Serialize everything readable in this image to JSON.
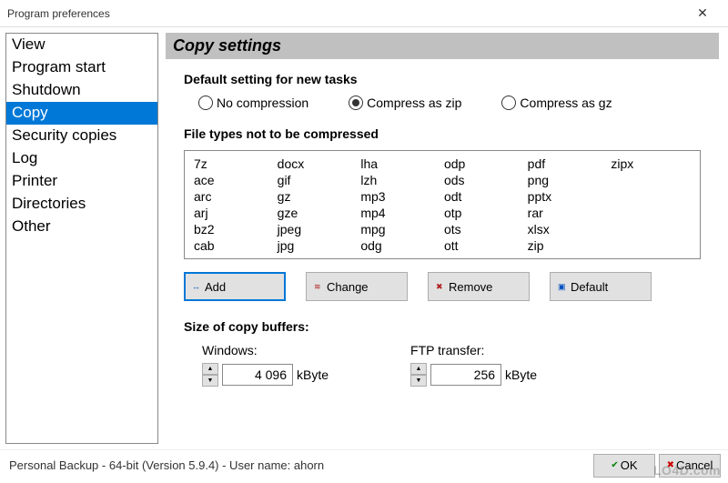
{
  "window": {
    "title": "Program preferences"
  },
  "sidebar": {
    "items": [
      {
        "label": "View"
      },
      {
        "label": "Program start"
      },
      {
        "label": "Shutdown"
      },
      {
        "label": "Copy"
      },
      {
        "label": "Security copies"
      },
      {
        "label": "Log"
      },
      {
        "label": "Printer"
      },
      {
        "label": "Directories"
      },
      {
        "label": "Other"
      }
    ],
    "selected_index": 3
  },
  "section": {
    "header": "Copy settings",
    "default_heading": "Default setting for new tasks",
    "radios": {
      "none": "No compression",
      "zip": "Compress as zip",
      "gz": "Compress as gz",
      "selected": "zip"
    },
    "filetypes_heading": "File types not to be compressed",
    "filetypes_columns": [
      [
        "7z",
        "ace",
        "arc",
        "arj",
        "bz2",
        "cab"
      ],
      [
        "docx",
        "gif",
        "gz",
        "gze",
        "jpeg",
        "jpg"
      ],
      [
        "lha",
        "lzh",
        "mp3",
        "mp4",
        "mpg",
        "odg"
      ],
      [
        "odp",
        "ods",
        "odt",
        "otp",
        "ots",
        "ott"
      ],
      [
        "pdf",
        "png",
        "pptx",
        "rar",
        "xlsx",
        "zip"
      ],
      [
        "zipx",
        "",
        "",
        "",
        "",
        ""
      ]
    ],
    "buttons": {
      "add": "Add",
      "change": "Change",
      "remove": "Remove",
      "default": "Default"
    },
    "buffers": {
      "heading": "Size of copy buffers:",
      "windows_label": "Windows:",
      "windows_value": "4 096",
      "ftp_label": "FTP transfer:",
      "ftp_value": "256",
      "unit": "kByte"
    }
  },
  "footer": {
    "status": "Personal Backup - 64-bit (Version 5.9.4) - User name: ahorn",
    "ok": "OK",
    "cancel": "Cancel"
  },
  "watermark": "LO4D.com"
}
